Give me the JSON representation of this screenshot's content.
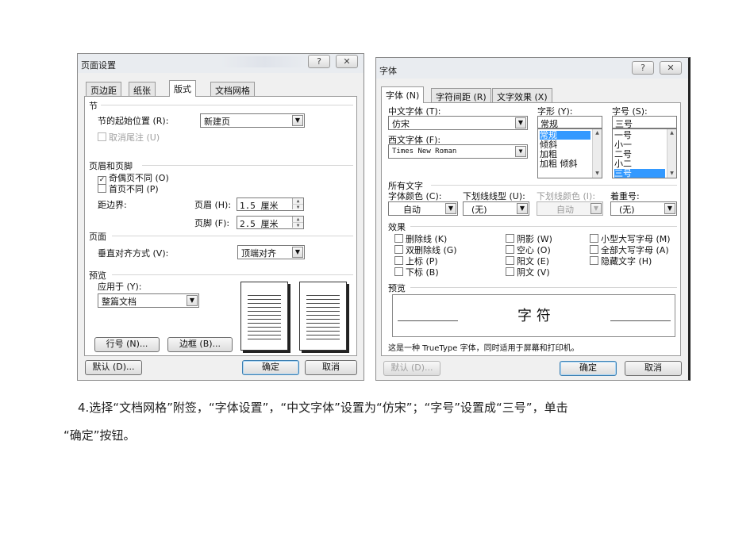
{
  "page_setup": {
    "title": "页面设置",
    "help": "?",
    "close": "✕",
    "tabs": [
      "页边距",
      "纸张",
      "版式",
      "文档网格"
    ],
    "section": {
      "title": "节",
      "start_label": "节的起始位置 (R):",
      "start_value": "新建页",
      "suppress_endnotes": "取消尾注 (U)"
    },
    "header_footer": {
      "title": "页眉和页脚",
      "odd_even": "奇偶页不同 (O)",
      "first_page": "首页不同 (P)",
      "distance_label": "距边界:",
      "header_label": "页眉 (H):",
      "header_value": "1.5 厘米",
      "footer_label": "页脚 (F):",
      "footer_value": "2.5 厘米"
    },
    "page": {
      "title": "页面",
      "valign_label": "垂直对齐方式 (V):",
      "valign_value": "顶端对齐"
    },
    "preview": {
      "title": "预览",
      "apply_label": "应用于 (Y):",
      "apply_value": "整篇文档"
    },
    "line_numbers": "行号 (N)...",
    "borders": "边框 (B)...",
    "default": "默认 (D)...",
    "ok": "确定",
    "cancel": "取消"
  },
  "font": {
    "title": "字体",
    "help": "?",
    "close": "✕",
    "tabs": [
      "字体 (N)",
      "字符间距 (R)",
      "文字效果 (X)"
    ],
    "cn_font_label": "中文字体 (T):",
    "cn_font_value": "仿宋",
    "west_font_label": "西文字体 (F):",
    "west_font_value": "Times New Roman",
    "style_label": "字形 (Y):",
    "style_value": "常规",
    "style_options": [
      "常规",
      "倾斜",
      "加粗",
      "加粗 倾斜"
    ],
    "size_label": "字号 (S):",
    "size_value": "三号",
    "size_options": [
      "一号",
      "小一",
      "二号",
      "小二",
      "三号"
    ],
    "all_text": {
      "title": "所有文字",
      "color_label": "字体颜色 (C):",
      "color_value": "自动",
      "underline_label": "下划线线型 (U):",
      "underline_value": "(无)",
      "underline_color_label": "下划线颜色 (I):",
      "underline_color_value": "自动",
      "emphasis_label": "着重号:",
      "emphasis_value": "(无)"
    },
    "effects": {
      "title": "效果",
      "col1": [
        "删除线 (K)",
        "双删除线 (G)",
        "上标 (P)",
        "下标 (B)"
      ],
      "col2": [
        "阴影 (W)",
        "空心 (O)",
        "阳文 (E)",
        "阴文 (V)"
      ],
      "col3": [
        "小型大写字母 (M)",
        "全部大写字母 (A)",
        "隐藏文字 (H)"
      ]
    },
    "preview_title": "预览",
    "preview_sample": "字 符",
    "note": "这是一种 TrueType 字体，同时适用于屏幕和打印机。",
    "default": "默认 (D)...",
    "ok": "确定",
    "cancel": "取消"
  },
  "caption": {
    "line1": "4.选择“文档网格”附签，“字体设置”，“中文字体”设置为“仿宋”；“字号”设置成“三号”，单击",
    "line2": "“确定”按钮。"
  }
}
